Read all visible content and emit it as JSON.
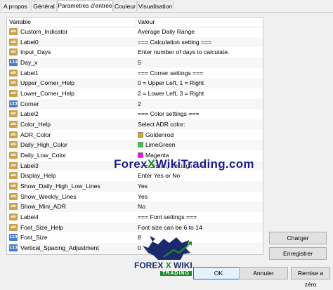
{
  "tabs": [
    {
      "label": "A propos"
    },
    {
      "label": "Général"
    },
    {
      "label": "Parametres d'entrée"
    },
    {
      "label": "Couleur"
    },
    {
      "label": "Visualisation"
    }
  ],
  "grid": {
    "col_variable": "Variable",
    "col_value": "Valeur",
    "rows": [
      {
        "type": "ab",
        "name": "Custom_Indicator",
        "value": "Average Daily Range"
      },
      {
        "type": "ab",
        "name": "Label0",
        "value": "=== Calculation setting ==="
      },
      {
        "type": "ab",
        "name": "Input_Days",
        "value": "Enter number of days to calculate."
      },
      {
        "type": "123",
        "name": "Day_x",
        "value": "5"
      },
      {
        "type": "ab",
        "name": "Label1",
        "value": "=== Corner settings ==="
      },
      {
        "type": "ab",
        "name": "Upper_Corner_Help",
        "value": "0 = Upper Left, 1 = Right"
      },
      {
        "type": "ab",
        "name": "Lower_Corner_Help",
        "value": "2 = Lower Left, 3 = Right"
      },
      {
        "type": "123",
        "name": "Corner",
        "value": "2"
      },
      {
        "type": "ab",
        "name": "Label2",
        "value": "=== Color settings ==="
      },
      {
        "type": "ab",
        "name": "Color_Help",
        "value": "Select ADR color:"
      },
      {
        "type": "ab",
        "name": "ADR_Color",
        "value": "Goldenrod",
        "swatch": "#daa520"
      },
      {
        "type": "ab",
        "name": "Daily_High_Color",
        "value": "LimeGreen",
        "swatch": "#32cd32"
      },
      {
        "type": "ab",
        "name": "Daily_Low_Color",
        "value": "Magenta",
        "swatch": "#ff00ff"
      },
      {
        "type": "ab",
        "name": "Label3",
        "value": "=== Display settings ==="
      },
      {
        "type": "ab",
        "name": "Display_Help",
        "value": "Enter Yes or No"
      },
      {
        "type": "ab",
        "name": "Show_Daily_High_Low_Lines",
        "value": "Yes"
      },
      {
        "type": "ab",
        "name": "Show_Weekly_Lines",
        "value": "Yes"
      },
      {
        "type": "ab",
        "name": "Show_Mini_ADR",
        "value": "No"
      },
      {
        "type": "ab",
        "name": "Label4",
        "value": "=== Font settings ==="
      },
      {
        "type": "ab",
        "name": "Font_Size_Help",
        "value": "Font size can be 6 to 14"
      },
      {
        "type": "123",
        "name": "Font_Size",
        "value": "8"
      },
      {
        "type": "123",
        "name": "Vertical_Spacing_Adjustment",
        "value": "0"
      }
    ]
  },
  "buttons": {
    "load": "Charger",
    "save": "Enregistrer",
    "ok": "OK",
    "cancel": "Annuler",
    "reset": "Remise a zéro"
  },
  "watermark": {
    "pre": "Forex",
    "x": "X",
    "post": "WikiTrading.com"
  },
  "logo": {
    "pre": "FOREX",
    "x": "X",
    "post": "WIKI",
    "sub": "TRADING"
  },
  "colors": {
    "accent": "#0078d7",
    "ab_icon": "#c9a24a",
    "num_icon": "#4a7cc9",
    "brand_green": "#1f8a2d",
    "brand_blue": "#1a2a6c"
  }
}
